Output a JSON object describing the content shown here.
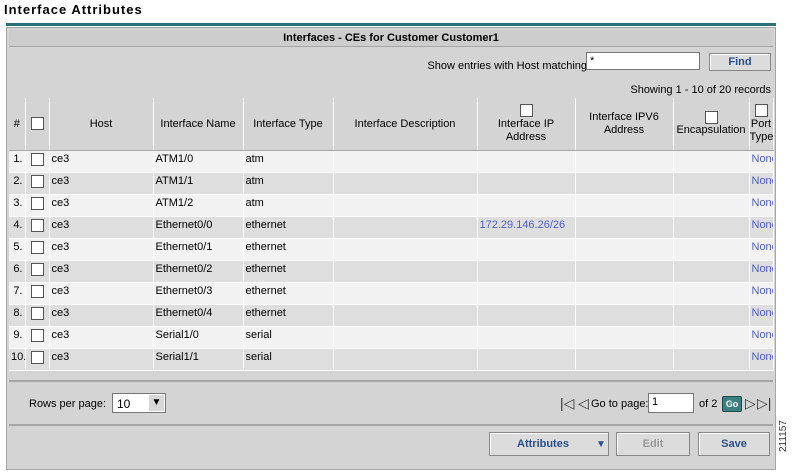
{
  "page": {
    "title": "Interface Attributes",
    "figure_id": "211157"
  },
  "section": {
    "title": "Interfaces - CEs for Customer Customer1"
  },
  "filter": {
    "label": "Show entries with Host matching",
    "value": "*",
    "button": "Find"
  },
  "records": {
    "text": "Showing 1 - 10 of 20 records"
  },
  "table": {
    "headers": {
      "num": "#",
      "host": "Host",
      "interface_name": "Interface Name",
      "interface_type": "Interface Type",
      "interface_description": "Interface Description",
      "interface_ip": "Interface IP Address",
      "interface_ipv6": "Interface IPV6 Address",
      "encapsulation": "Encapsulation",
      "port_type": "Port Type"
    },
    "rows": [
      {
        "num": "1.",
        "host": "ce3",
        "name": "ATM1/0",
        "type": "atm",
        "desc": "",
        "ip": "",
        "ipv6": "",
        "encap": "",
        "port": "None"
      },
      {
        "num": "2.",
        "host": "ce3",
        "name": "ATM1/1",
        "type": "atm",
        "desc": "",
        "ip": "",
        "ipv6": "",
        "encap": "",
        "port": "None"
      },
      {
        "num": "3.",
        "host": "ce3",
        "name": "ATM1/2",
        "type": "atm",
        "desc": "",
        "ip": "",
        "ipv6": "",
        "encap": "",
        "port": "None"
      },
      {
        "num": "4.",
        "host": "ce3",
        "name": "Ethernet0/0",
        "type": "ethernet",
        "desc": "",
        "ip": "172.29.146.26/26",
        "ipv6": "",
        "encap": "",
        "port": "None"
      },
      {
        "num": "5.",
        "host": "ce3",
        "name": "Ethernet0/1",
        "type": "ethernet",
        "desc": "",
        "ip": "",
        "ipv6": "",
        "encap": "",
        "port": "None"
      },
      {
        "num": "6.",
        "host": "ce3",
        "name": "Ethernet0/2",
        "type": "ethernet",
        "desc": "",
        "ip": "",
        "ipv6": "",
        "encap": "",
        "port": "None"
      },
      {
        "num": "7.",
        "host": "ce3",
        "name": "Ethernet0/3",
        "type": "ethernet",
        "desc": "",
        "ip": "",
        "ipv6": "",
        "encap": "",
        "port": "None"
      },
      {
        "num": "8.",
        "host": "ce3",
        "name": "Ethernet0/4",
        "type": "ethernet",
        "desc": "",
        "ip": "",
        "ipv6": "",
        "encap": "",
        "port": "None"
      },
      {
        "num": "9.",
        "host": "ce3",
        "name": "Serial1/0",
        "type": "serial",
        "desc": "",
        "ip": "",
        "ipv6": "",
        "encap": "",
        "port": "None"
      },
      {
        "num": "10.",
        "host": "ce3",
        "name": "Serial1/1",
        "type": "serial",
        "desc": "",
        "ip": "",
        "ipv6": "",
        "encap": "",
        "port": "None"
      }
    ]
  },
  "pager": {
    "rows_label": "Rows per page:",
    "rows_value": "10",
    "goto_label": "Go to page:",
    "page_value": "1",
    "of_label": "of 2",
    "go_button": "Go"
  },
  "actions": {
    "attributes": "Attributes",
    "edit": "Edit",
    "save": "Save"
  }
}
